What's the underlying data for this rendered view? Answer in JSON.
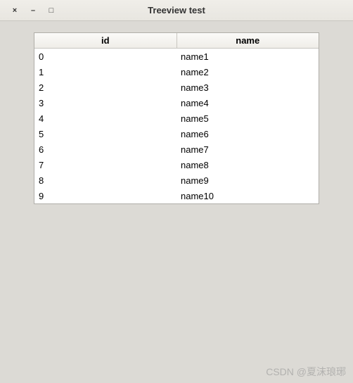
{
  "window": {
    "title": "Treeview test",
    "close_glyph": "×",
    "minimize_glyph": "–",
    "maximize_glyph": "□"
  },
  "treeview": {
    "columns": [
      {
        "label": "id"
      },
      {
        "label": "name"
      }
    ],
    "rows": [
      {
        "id": "0",
        "name": "name1"
      },
      {
        "id": "1",
        "name": "name2"
      },
      {
        "id": "2",
        "name": "name3"
      },
      {
        "id": "3",
        "name": "name4"
      },
      {
        "id": "4",
        "name": "name5"
      },
      {
        "id": "5",
        "name": "name6"
      },
      {
        "id": "6",
        "name": "name7"
      },
      {
        "id": "7",
        "name": "name8"
      },
      {
        "id": "8",
        "name": "name9"
      },
      {
        "id": "9",
        "name": "name10"
      }
    ]
  },
  "watermark": "CSDN @夏沫琅琊"
}
